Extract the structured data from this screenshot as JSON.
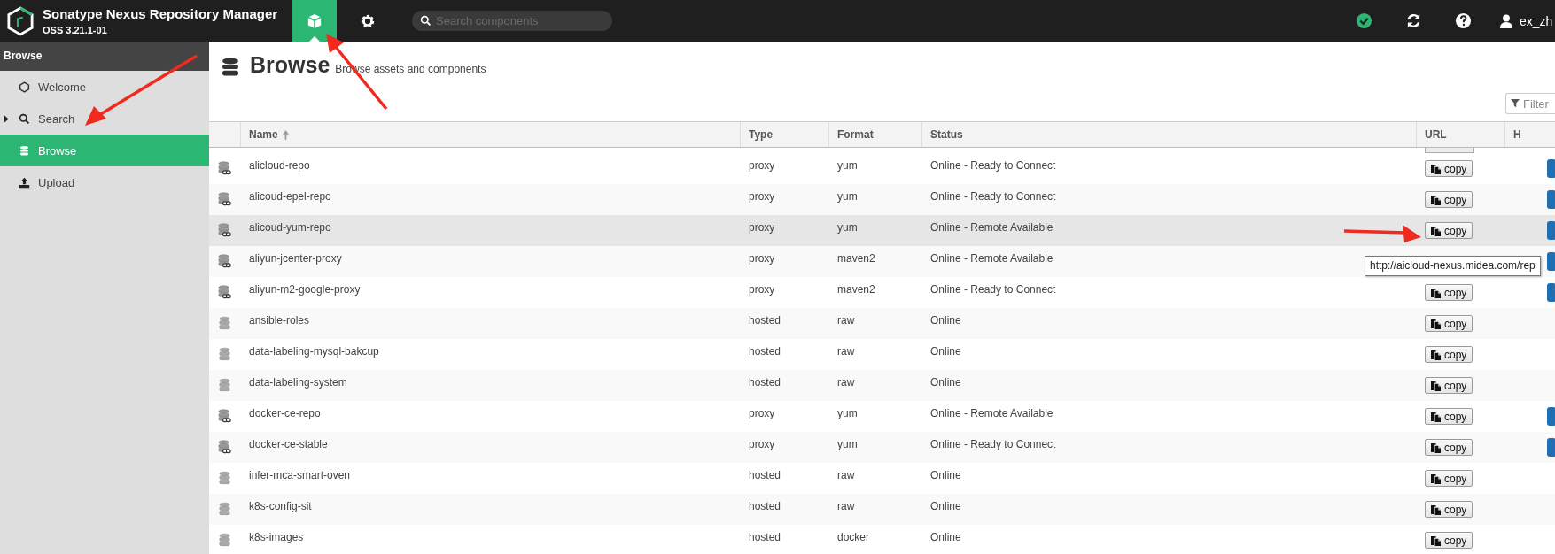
{
  "header": {
    "title": "Sonatype Nexus Repository Manager",
    "version": "OSS 3.21.1-01",
    "modes": [
      {
        "kind": "browse",
        "selected": true
      },
      {
        "kind": "admin",
        "selected": false
      }
    ],
    "search": {
      "placeholder": "Search components"
    },
    "user": "ex_zh"
  },
  "sidebar": {
    "title": "Browse",
    "items": [
      {
        "label": "Welcome",
        "kind": "welcome",
        "selected": false,
        "expandable": false
      },
      {
        "label": "Search",
        "kind": "search",
        "selected": false,
        "expandable": true
      },
      {
        "label": "Browse",
        "kind": "browse",
        "selected": true,
        "expandable": false
      },
      {
        "label": "Upload",
        "kind": "upload",
        "selected": false,
        "expandable": false
      }
    ]
  },
  "page": {
    "title": "Browse",
    "subtitle": "Browse assets and components",
    "filter": {
      "placeholder": "Filter"
    }
  },
  "table": {
    "columns": [
      "Name",
      "Type",
      "Format",
      "Status",
      "URL",
      "H"
    ],
    "rows": [
      {
        "name": "alicloud-repo",
        "type": "proxy",
        "format": "yum",
        "status": "Online - Ready to Connect",
        "copy": "copy",
        "kind": "proxy",
        "selected": false
      },
      {
        "name": "alicoud-epel-repo",
        "type": "proxy",
        "format": "yum",
        "status": "Online - Ready to Connect",
        "copy": "copy",
        "kind": "proxy",
        "selected": false
      },
      {
        "name": "alicoud-yum-repo",
        "type": "proxy",
        "format": "yum",
        "status": "Online - Remote Available",
        "copy": "copy",
        "kind": "proxy",
        "selected": true
      },
      {
        "name": "aliyun-jcenter-proxy",
        "type": "proxy",
        "format": "maven2",
        "status": "Online - Remote Available",
        "kind": "proxy",
        "selected": false
      },
      {
        "name": "aliyun-m2-google-proxy",
        "type": "proxy",
        "format": "maven2",
        "status": "Online - Ready to Connect",
        "copy": "copy",
        "kind": "proxy",
        "selected": false
      },
      {
        "name": "ansible-roles",
        "type": "hosted",
        "format": "raw",
        "status": "Online",
        "copy": "copy",
        "kind": "hosted",
        "selected": false
      },
      {
        "name": "data-labeling-mysql-bakcup",
        "type": "hosted",
        "format": "raw",
        "status": "Online",
        "copy": "copy",
        "kind": "hosted",
        "selected": false
      },
      {
        "name": "data-labeling-system",
        "type": "hosted",
        "format": "raw",
        "status": "Online",
        "copy": "copy",
        "kind": "hosted",
        "selected": false
      },
      {
        "name": "docker-ce-repo",
        "type": "proxy",
        "format": "yum",
        "status": "Online - Remote Available",
        "copy": "copy",
        "kind": "proxy",
        "selected": false
      },
      {
        "name": "docker-ce-stable",
        "type": "proxy",
        "format": "yum",
        "status": "Online - Ready to Connect",
        "copy": "copy",
        "kind": "proxy",
        "selected": false
      },
      {
        "name": "infer-mca-smart-oven",
        "type": "hosted",
        "format": "raw",
        "status": "Online",
        "copy": "copy",
        "kind": "hosted",
        "selected": false
      },
      {
        "name": "k8s-config-sit",
        "type": "hosted",
        "format": "raw",
        "status": "Online",
        "copy": "copy",
        "kind": "hosted",
        "selected": false
      },
      {
        "name": "k8s-images",
        "type": "hosted",
        "format": "docker",
        "status": "Online",
        "copy": "copy",
        "kind": "hosted",
        "selected": false
      }
    ]
  },
  "tooltip": "http://aicloud-nexus.midea.com/rep"
}
